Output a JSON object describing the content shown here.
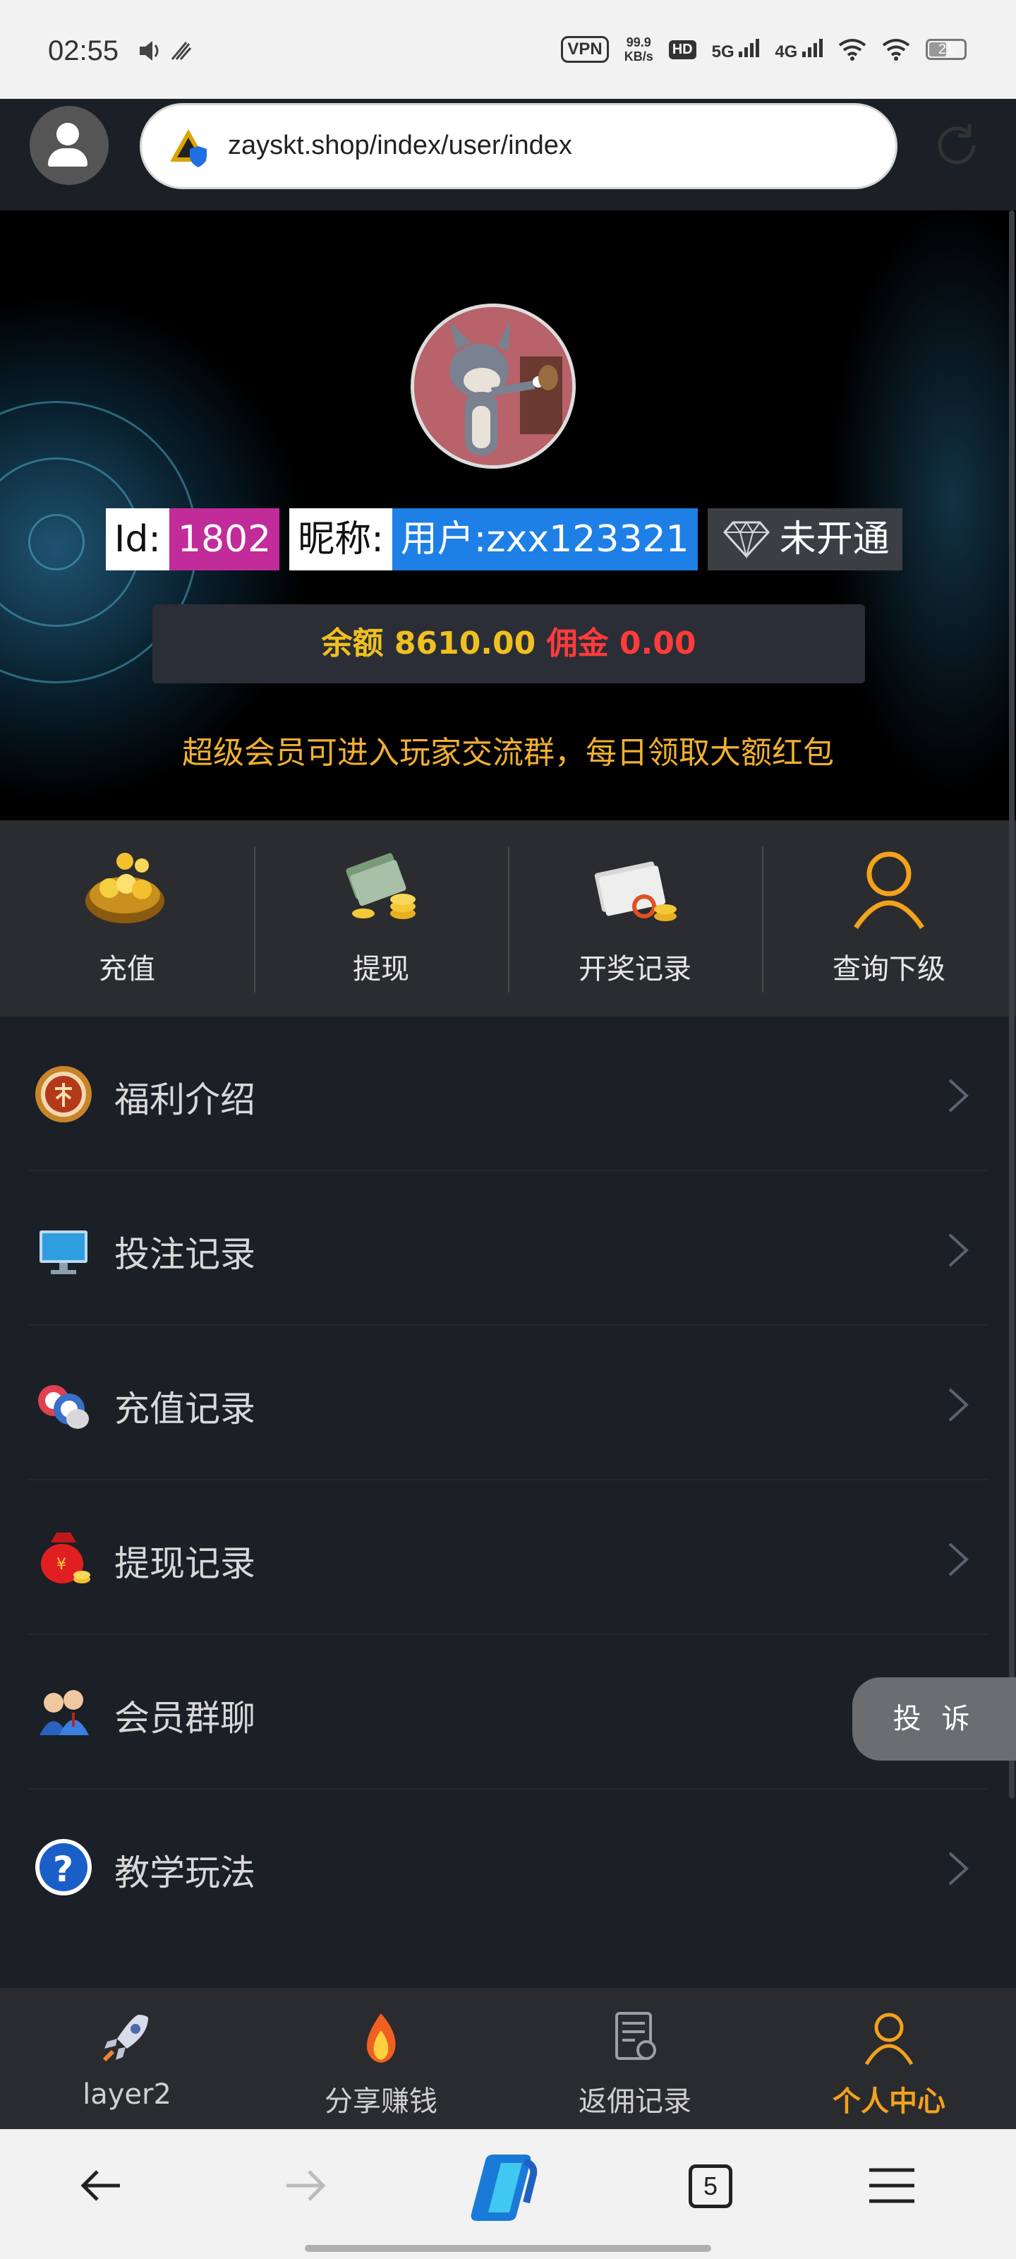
{
  "status_bar": {
    "time": "02:55",
    "vpn": "VPN",
    "speed_value": "99.9",
    "speed_unit": "KB/s",
    "hd": "HD",
    "net1": "5G",
    "net2": "4G",
    "battery": "21"
  },
  "browser": {
    "url": "zayskt.shop/index/user/index",
    "tab_count": "5"
  },
  "profile": {
    "id_label": "Id:",
    "id_value": "1802",
    "nick_label": "昵称:",
    "nick_value": "用户:zxx123321",
    "vip_status": "未开通",
    "balance_label": "余额",
    "balance_value": "8610.00",
    "commission_label": "佣金",
    "commission_value": "0.00",
    "notice": "超级会员可进入玩家交流群，每日领取大额红包"
  },
  "quick_actions": [
    {
      "label": "充值",
      "icon": "money-bag-icon"
    },
    {
      "label": "提现",
      "icon": "cash-coins-icon"
    },
    {
      "label": "开奖记录",
      "icon": "records-coins-icon"
    },
    {
      "label": "查询下级",
      "icon": "user-icon"
    }
  ],
  "menu": [
    {
      "label": "福利介绍",
      "icon": "award-medal-icon"
    },
    {
      "label": "投注记录",
      "icon": "monitor-icon"
    },
    {
      "label": "充值记录",
      "icon": "chips-icon"
    },
    {
      "label": "提现记录",
      "icon": "red-bag-icon"
    },
    {
      "label": "会员群聊",
      "icon": "group-icon"
    },
    {
      "label": "教学玩法",
      "icon": "help-icon"
    }
  ],
  "complaint_label": "投 诉",
  "bottom_nav": [
    {
      "label": "layer2",
      "icon": "rocket-icon"
    },
    {
      "label": "分享赚钱",
      "icon": "flame-icon"
    },
    {
      "label": "返佣记录",
      "icon": "document-icon"
    },
    {
      "label": "个人中心",
      "icon": "user-icon",
      "active": true
    }
  ],
  "colors": {
    "accent": "#f3a21c",
    "id_tag": "#c12c9a",
    "nick_tag": "#1e7fe6",
    "balance_gold": "#f0c020",
    "commission_red": "#ff3b3b"
  }
}
